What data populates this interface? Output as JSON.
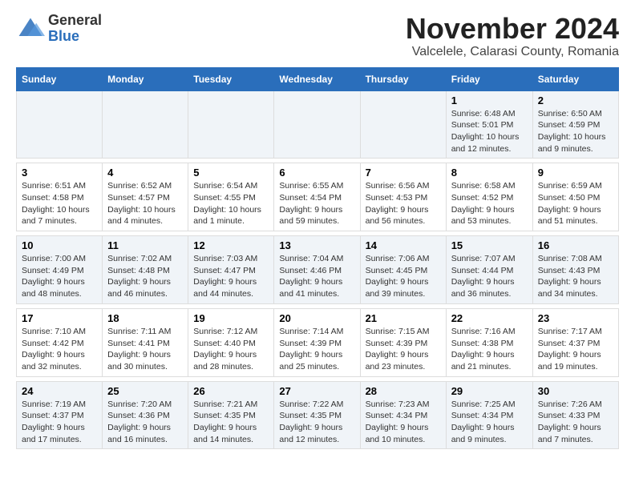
{
  "title": "November 2024",
  "subtitle": "Valcelele, Calarasi County, Romania",
  "logo": {
    "general": "General",
    "blue": "Blue"
  },
  "days_of_week": [
    "Sunday",
    "Monday",
    "Tuesday",
    "Wednesday",
    "Thursday",
    "Friday",
    "Saturday"
  ],
  "weeks": [
    {
      "days": [
        {
          "num": "",
          "info": ""
        },
        {
          "num": "",
          "info": ""
        },
        {
          "num": "",
          "info": ""
        },
        {
          "num": "",
          "info": ""
        },
        {
          "num": "",
          "info": ""
        },
        {
          "num": "1",
          "info": "Sunrise: 6:48 AM\nSunset: 5:01 PM\nDaylight: 10 hours and 12 minutes."
        },
        {
          "num": "2",
          "info": "Sunrise: 6:50 AM\nSunset: 4:59 PM\nDaylight: 10 hours and 9 minutes."
        }
      ]
    },
    {
      "days": [
        {
          "num": "3",
          "info": "Sunrise: 6:51 AM\nSunset: 4:58 PM\nDaylight: 10 hours and 7 minutes."
        },
        {
          "num": "4",
          "info": "Sunrise: 6:52 AM\nSunset: 4:57 PM\nDaylight: 10 hours and 4 minutes."
        },
        {
          "num": "5",
          "info": "Sunrise: 6:54 AM\nSunset: 4:55 PM\nDaylight: 10 hours and 1 minute."
        },
        {
          "num": "6",
          "info": "Sunrise: 6:55 AM\nSunset: 4:54 PM\nDaylight: 9 hours and 59 minutes."
        },
        {
          "num": "7",
          "info": "Sunrise: 6:56 AM\nSunset: 4:53 PM\nDaylight: 9 hours and 56 minutes."
        },
        {
          "num": "8",
          "info": "Sunrise: 6:58 AM\nSunset: 4:52 PM\nDaylight: 9 hours and 53 minutes."
        },
        {
          "num": "9",
          "info": "Sunrise: 6:59 AM\nSunset: 4:50 PM\nDaylight: 9 hours and 51 minutes."
        }
      ]
    },
    {
      "days": [
        {
          "num": "10",
          "info": "Sunrise: 7:00 AM\nSunset: 4:49 PM\nDaylight: 9 hours and 48 minutes."
        },
        {
          "num": "11",
          "info": "Sunrise: 7:02 AM\nSunset: 4:48 PM\nDaylight: 9 hours and 46 minutes."
        },
        {
          "num": "12",
          "info": "Sunrise: 7:03 AM\nSunset: 4:47 PM\nDaylight: 9 hours and 44 minutes."
        },
        {
          "num": "13",
          "info": "Sunrise: 7:04 AM\nSunset: 4:46 PM\nDaylight: 9 hours and 41 minutes."
        },
        {
          "num": "14",
          "info": "Sunrise: 7:06 AM\nSunset: 4:45 PM\nDaylight: 9 hours and 39 minutes."
        },
        {
          "num": "15",
          "info": "Sunrise: 7:07 AM\nSunset: 4:44 PM\nDaylight: 9 hours and 36 minutes."
        },
        {
          "num": "16",
          "info": "Sunrise: 7:08 AM\nSunset: 4:43 PM\nDaylight: 9 hours and 34 minutes."
        }
      ]
    },
    {
      "days": [
        {
          "num": "17",
          "info": "Sunrise: 7:10 AM\nSunset: 4:42 PM\nDaylight: 9 hours and 32 minutes."
        },
        {
          "num": "18",
          "info": "Sunrise: 7:11 AM\nSunset: 4:41 PM\nDaylight: 9 hours and 30 minutes."
        },
        {
          "num": "19",
          "info": "Sunrise: 7:12 AM\nSunset: 4:40 PM\nDaylight: 9 hours and 28 minutes."
        },
        {
          "num": "20",
          "info": "Sunrise: 7:14 AM\nSunset: 4:39 PM\nDaylight: 9 hours and 25 minutes."
        },
        {
          "num": "21",
          "info": "Sunrise: 7:15 AM\nSunset: 4:39 PM\nDaylight: 9 hours and 23 minutes."
        },
        {
          "num": "22",
          "info": "Sunrise: 7:16 AM\nSunset: 4:38 PM\nDaylight: 9 hours and 21 minutes."
        },
        {
          "num": "23",
          "info": "Sunrise: 7:17 AM\nSunset: 4:37 PM\nDaylight: 9 hours and 19 minutes."
        }
      ]
    },
    {
      "days": [
        {
          "num": "24",
          "info": "Sunrise: 7:19 AM\nSunset: 4:37 PM\nDaylight: 9 hours and 17 minutes."
        },
        {
          "num": "25",
          "info": "Sunrise: 7:20 AM\nSunset: 4:36 PM\nDaylight: 9 hours and 16 minutes."
        },
        {
          "num": "26",
          "info": "Sunrise: 7:21 AM\nSunset: 4:35 PM\nDaylight: 9 hours and 14 minutes."
        },
        {
          "num": "27",
          "info": "Sunrise: 7:22 AM\nSunset: 4:35 PM\nDaylight: 9 hours and 12 minutes."
        },
        {
          "num": "28",
          "info": "Sunrise: 7:23 AM\nSunset: 4:34 PM\nDaylight: 9 hours and 10 minutes."
        },
        {
          "num": "29",
          "info": "Sunrise: 7:25 AM\nSunset: 4:34 PM\nDaylight: 9 hours and 9 minutes."
        },
        {
          "num": "30",
          "info": "Sunrise: 7:26 AM\nSunset: 4:33 PM\nDaylight: 9 hours and 7 minutes."
        }
      ]
    }
  ]
}
